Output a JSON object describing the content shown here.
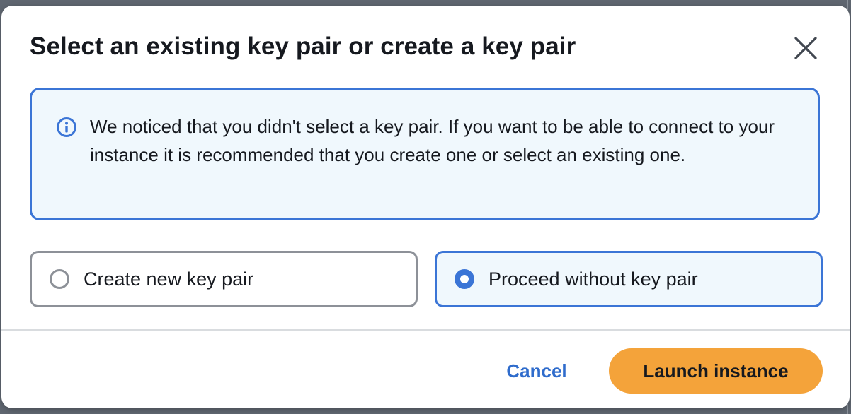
{
  "dialog": {
    "title": "Select an existing key pair or create a key pair",
    "close_icon": "close-icon"
  },
  "alert": {
    "icon": "info-icon",
    "message": "We noticed that you didn't select a key pair. If you want to be able to connect to your instance it is recommended that you create one or select an existing one."
  },
  "options": [
    {
      "label": "Create new key pair",
      "selected": false
    },
    {
      "label": "Proceed without key pair",
      "selected": true
    }
  ],
  "footer": {
    "cancel_label": "Cancel",
    "launch_label": "Launch instance"
  },
  "colors": {
    "primary_blue": "#3b75d6",
    "link_blue": "#2f6ccc",
    "launch_orange": "#f4a33a",
    "alert_background": "#f0f8fd"
  }
}
